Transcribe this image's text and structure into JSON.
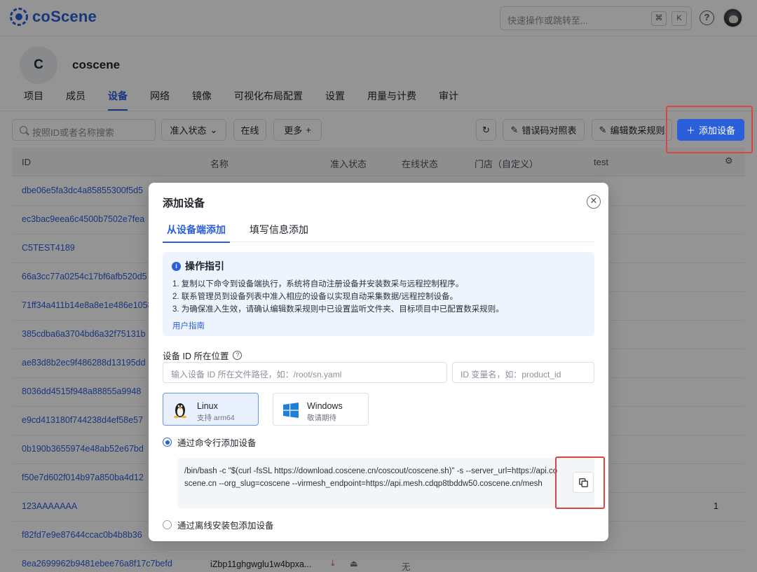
{
  "app": {
    "brand": "coScene"
  },
  "header": {
    "search_placeholder": "快速操作或跳转至...",
    "kbd_cmd": "⌘",
    "kbd_k": "K",
    "help": "?"
  },
  "org": {
    "avatar_letter": "C",
    "name": "coscene"
  },
  "tabs": [
    {
      "label": "项目"
    },
    {
      "label": "成员"
    },
    {
      "label": "设备",
      "active": true
    },
    {
      "label": "网络"
    },
    {
      "label": "镜像"
    },
    {
      "label": "可视化布局配置"
    },
    {
      "label": "设置"
    },
    {
      "label": "用量与计费"
    },
    {
      "label": "审计"
    }
  ],
  "toolbar": {
    "search_placeholder": "按照ID或者名称搜索",
    "admission_filter": "准入状态",
    "online_filter": "在线",
    "more_filter": "更多",
    "error_code_btn": "错误码对照表",
    "edit_rules_btn": "编辑数采规则",
    "add_device_btn": "添加设备"
  },
  "table": {
    "columns": [
      "ID",
      "名称",
      "准入状态",
      "在线状态",
      "门店（自定义）",
      "test"
    ],
    "rows": [
      {
        "id": "dbe06e5fa3dc4a85855300f5d5"
      },
      {
        "id": "ec3bac9eea6c4500b7502e7fea"
      },
      {
        "id": "C5TEST4189"
      },
      {
        "id": "66a3cc77a0254c17bf6afb520d5"
      },
      {
        "id": "71ff34a411b14e8a8e1e486e1058"
      },
      {
        "id": "385cdba6a3704bd6a32f75131b"
      },
      {
        "id": "ae83d8b2ec9f486288d13195dd"
      },
      {
        "id": "8036dd4515f948a88855a9948"
      },
      {
        "id": "e9cd413180f744238d4ef58e57"
      },
      {
        "id": "0b190b3655974e48ab52e67bd"
      },
      {
        "id": "f50e7d602f014b97a850ba4d12"
      },
      {
        "id": "123AAAAAAA",
        "test": "1"
      },
      {
        "id": "f82fd7e9e87644ccac0b4b8b36"
      },
      {
        "id": "8ea2699962b9481ebee76a8f17c7befd",
        "name": "iZbp11ghgwglu1w4bpxa...",
        "online": "无"
      }
    ]
  },
  "modal": {
    "title": "添加设备",
    "tabs": [
      "从设备端添加",
      "填写信息添加"
    ],
    "guide": {
      "title": "操作指引",
      "lines": [
        "1. 复制以下命令到设备端执行，系统将自动注册设备并安装数采与远程控制程序。",
        "2. 联系管理员到设备列表中准入相应的设备以实现自动采集数据/远程控制设备。",
        "3. 为确保准入生效，请确认编辑数采规则中已设置监听文件夹、目标项目中已配置数采规则。"
      ],
      "link": "用户指南"
    },
    "id_location_label": "设备 ID 所在位置",
    "path_placeholder": "输入设备 ID 所在文件路径，如：/root/sn.yaml",
    "var_placeholder": "ID 变量名，如：product_id",
    "os": [
      {
        "name": "Linux",
        "sub": "支持 arm64",
        "selected": true
      },
      {
        "name": "Windows",
        "sub": "敬请期待",
        "selected": false
      }
    ],
    "radio_cli": "通过命令行添加设备",
    "radio_offline": "通过离线安装包添加设备",
    "command": "/bin/bash -c \"$(curl -fsSL https://download.coscene.cn/coscout/coscene.sh)\" -s --server_url=https://api.coscene.cn --org_slug=coscene --virmesh_endpoint=https://api.mesh.cdqp8tbddw50.coscene.cn/mesh"
  },
  "colors": {
    "accent": "#2b5fd9",
    "highlight": "#d94545"
  }
}
